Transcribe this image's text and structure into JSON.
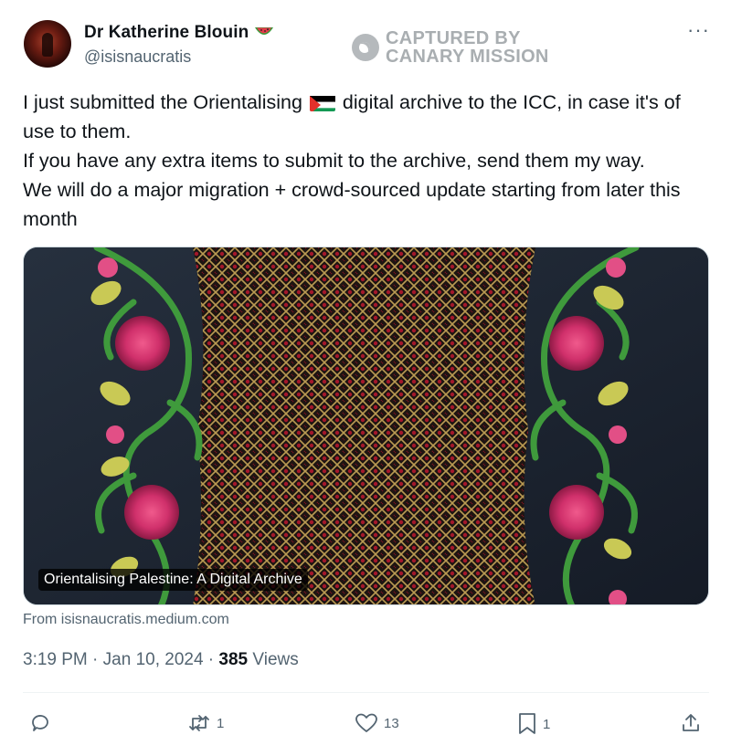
{
  "author": {
    "name": "Dr Katherine Blouin",
    "name_emoji": "watermelon-emoji",
    "handle": "@isisnaucratis"
  },
  "watermark": {
    "line1": "CAPTURED BY",
    "line2": "CANARY MISSION"
  },
  "more_icon": "ellipsis-icon",
  "tweet": {
    "line1_before_flag": "I just submitted the Orientalising",
    "flag_emoji": "palestine-flag-emoji",
    "line1_after_flag": " digital archive to the ICC, in case it's of use to them.",
    "line2": "If you have any extra items to submit to the archive, send them my way.",
    "line3": "We will do a major migration + crowd-sourced update starting from later this month"
  },
  "media": {
    "caption": "Orientalising Palestine: A Digital Archive",
    "image_description": "embroidery-image"
  },
  "source": "From isisnaucratis.medium.com",
  "meta": {
    "time": "3:19 PM",
    "sep1": " · ",
    "date": "Jan 10, 2024",
    "sep2": " · ",
    "views_count": "385",
    "views_label": " Views"
  },
  "actions": {
    "replies": "",
    "reposts": "1",
    "likes": "13",
    "bookmarks": "1"
  },
  "colors": {
    "text_primary": "#0f1419",
    "text_secondary": "#536471",
    "border": "#cfd9de"
  }
}
